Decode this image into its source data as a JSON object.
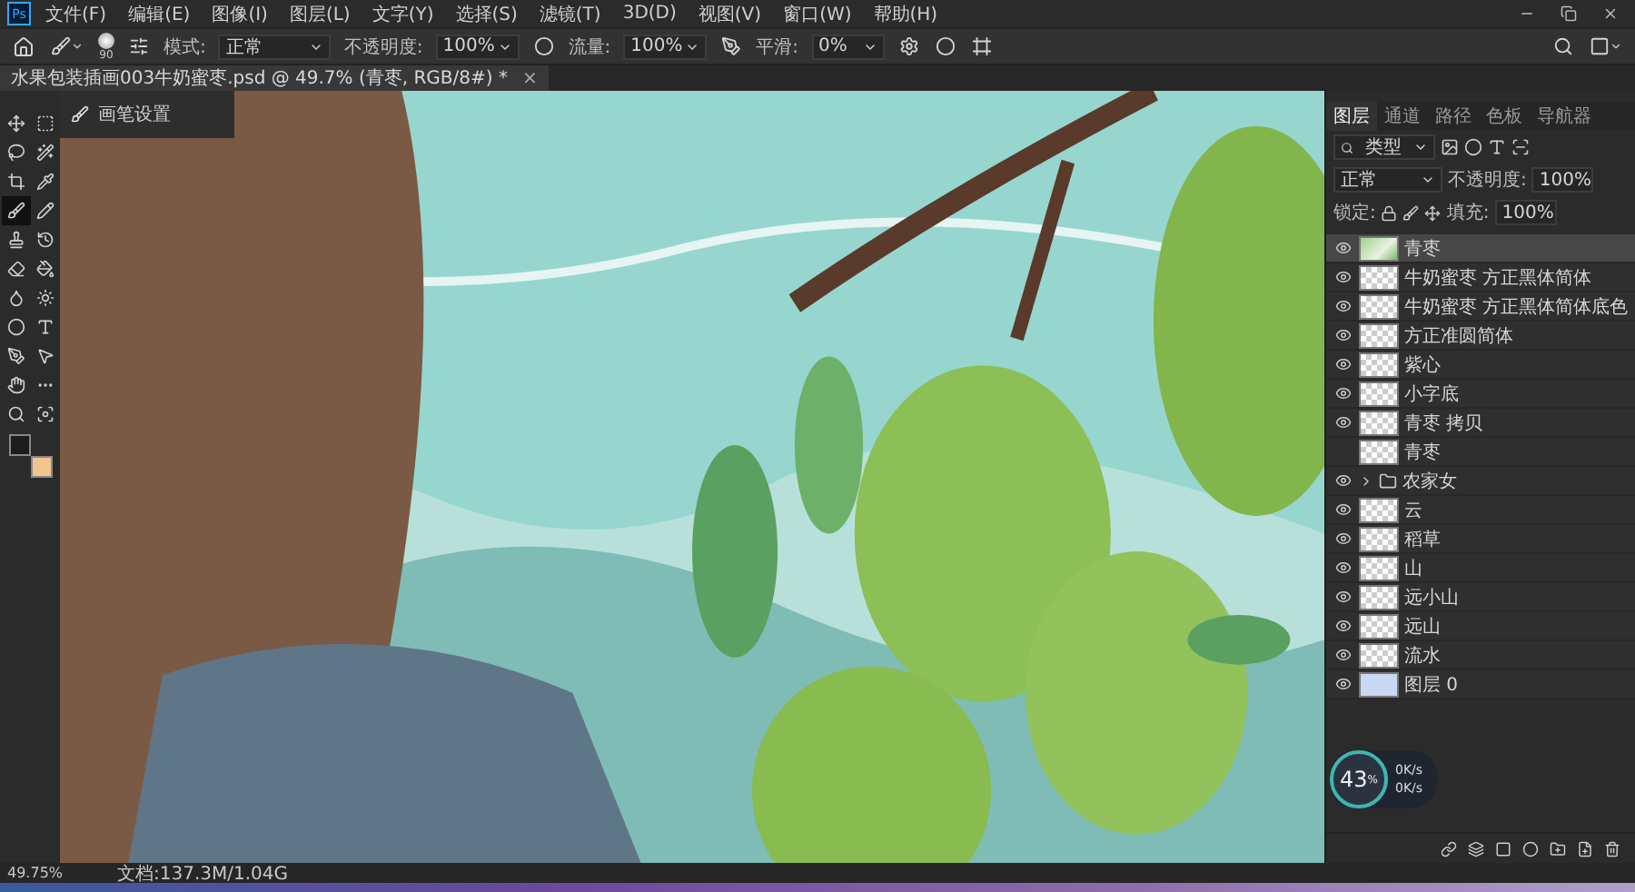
{
  "menu_bar": {
    "logo": "Ps",
    "items": [
      "文件(F)",
      "编辑(E)",
      "图像(I)",
      "图层(L)",
      "文字(Y)",
      "选择(S)",
      "滤镜(T)",
      "3D(D)",
      "视图(V)",
      "窗口(W)",
      "帮助(H)"
    ]
  },
  "options_bar": {
    "brush_size": "90",
    "mode_label": "模式:",
    "mode": "正常",
    "opacity_label": "不透明度:",
    "opacity": "100%",
    "flow_label": "流量:",
    "flow": "100%",
    "smoothing_label": "平滑:",
    "smoothing": "0%"
  },
  "document_tab": {
    "title": "水果包装插画003牛奶蜜枣.psd @ 49.7% (青枣, RGB/8#) *",
    "close": "×"
  },
  "tools": [
    {
      "selected": false
    },
    {
      "selected": false
    },
    {
      "selected": false
    },
    {
      "selected": false
    },
    {
      "selected": false
    },
    {
      "selected": false
    },
    {
      "selected": true
    },
    {
      "selected": false
    },
    {
      "selected": false
    },
    {
      "selected": false
    },
    {
      "selected": false
    },
    {
      "selected": false
    },
    {
      "selected": false
    },
    {
      "selected": false
    },
    {
      "selected": false
    },
    {
      "selected": false
    },
    {
      "selected": false
    },
    {
      "selected": false
    },
    {
      "selected": false
    },
    {
      "selected": false
    },
    {
      "selected": false
    },
    {
      "selected": false
    }
  ],
  "brush_panel": {
    "title": "画笔设置"
  },
  "layers_panel": {
    "tabs": [
      {
        "label": "图层",
        "selected": true
      },
      {
        "label": "通道",
        "selected": false
      },
      {
        "label": "路径",
        "selected": false
      },
      {
        "label": "色板",
        "selected": false
      },
      {
        "label": "导航器",
        "selected": false
      }
    ],
    "filter": "类型",
    "blend_mode": "正常",
    "opacity_label": "不透明度:",
    "opacity": "100%",
    "lock_label": "锁定:",
    "fill_label": "填充:",
    "fill": "100%",
    "layers": [
      {
        "name": "青枣",
        "kind": "picture-layer",
        "visible": true,
        "selected": true
      },
      {
        "name": "牛奶蜜枣  方正黑体简体",
        "kind": "layer",
        "visible": true,
        "selected": false
      },
      {
        "name": "牛奶蜜枣  方正黑体简体底色",
        "kind": "layer",
        "visible": true,
        "selected": false
      },
      {
        "name": "方正准圆简体",
        "kind": "layer",
        "visible": true,
        "selected": false
      },
      {
        "name": "紫心",
        "kind": "layer",
        "visible": true,
        "selected": false
      },
      {
        "name": "小字底",
        "kind": "layer",
        "visible": true,
        "selected": false
      },
      {
        "name": "青枣 拷贝",
        "kind": "layer",
        "visible": true,
        "selected": false
      },
      {
        "name": "青枣",
        "kind": "layer",
        "visible": false,
        "selected": false
      },
      {
        "name": "农家女",
        "kind": "group",
        "visible": true,
        "selected": false,
        "expanded": false
      },
      {
        "name": "云",
        "kind": "layer",
        "visible": true,
        "selected": false
      },
      {
        "name": "稻草",
        "kind": "layer",
        "visible": true,
        "selected": false
      },
      {
        "name": "山",
        "kind": "layer",
        "visible": true,
        "selected": false
      },
      {
        "name": "远小山",
        "kind": "layer",
        "visible": true,
        "selected": false
      },
      {
        "name": "远山",
        "kind": "layer",
        "visible": true,
        "selected": false
      },
      {
        "name": "流水",
        "kind": "layer",
        "visible": true,
        "selected": false
      },
      {
        "name": "图层 0",
        "kind": "solid-layer",
        "visible": true,
        "selected": false
      }
    ],
    "performance": {
      "percent": "43",
      "unit": "%",
      "upload": "0K/s",
      "download": "0K/s"
    }
  },
  "status_bar": {
    "zoom": "49.75%",
    "document": "文档:137.3M/1.04G"
  }
}
